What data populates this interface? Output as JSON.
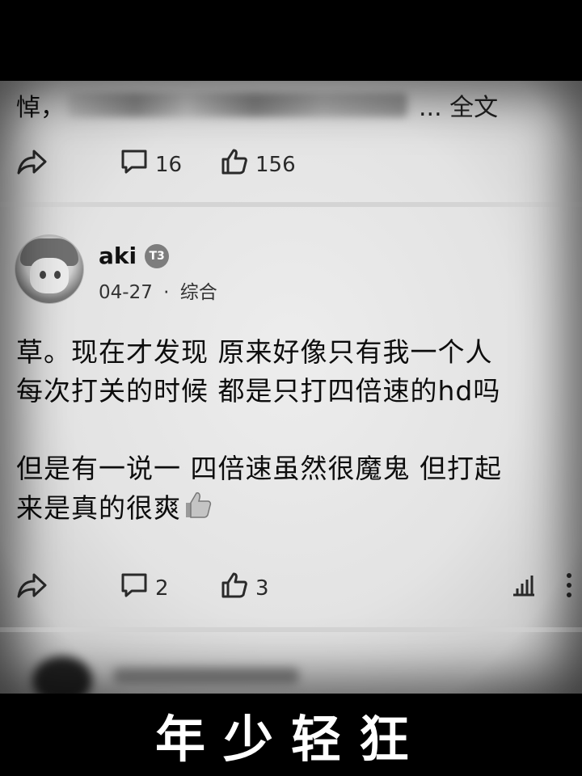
{
  "previous_post": {
    "text_start": "悼，",
    "text_end": "... 全文",
    "comments": "16",
    "likes": "156"
  },
  "post": {
    "username": "aki",
    "badge": "T3",
    "date": "04-27",
    "separator": "·",
    "category": "综合",
    "lines": [
      "草。现在才发现  原来好像只有我一个人",
      "每次打关的时候  都是只打四倍速的hd吗",
      "但是有一说一  四倍速虽然很魔鬼 但打起",
      "来是真的很爽"
    ],
    "comments": "2",
    "likes": "3"
  },
  "caption": "年少轻狂",
  "icons": [
    "share-icon",
    "comment-icon",
    "like-icon",
    "stats-icon",
    "more-icon",
    "thumbs-up-emoji"
  ]
}
